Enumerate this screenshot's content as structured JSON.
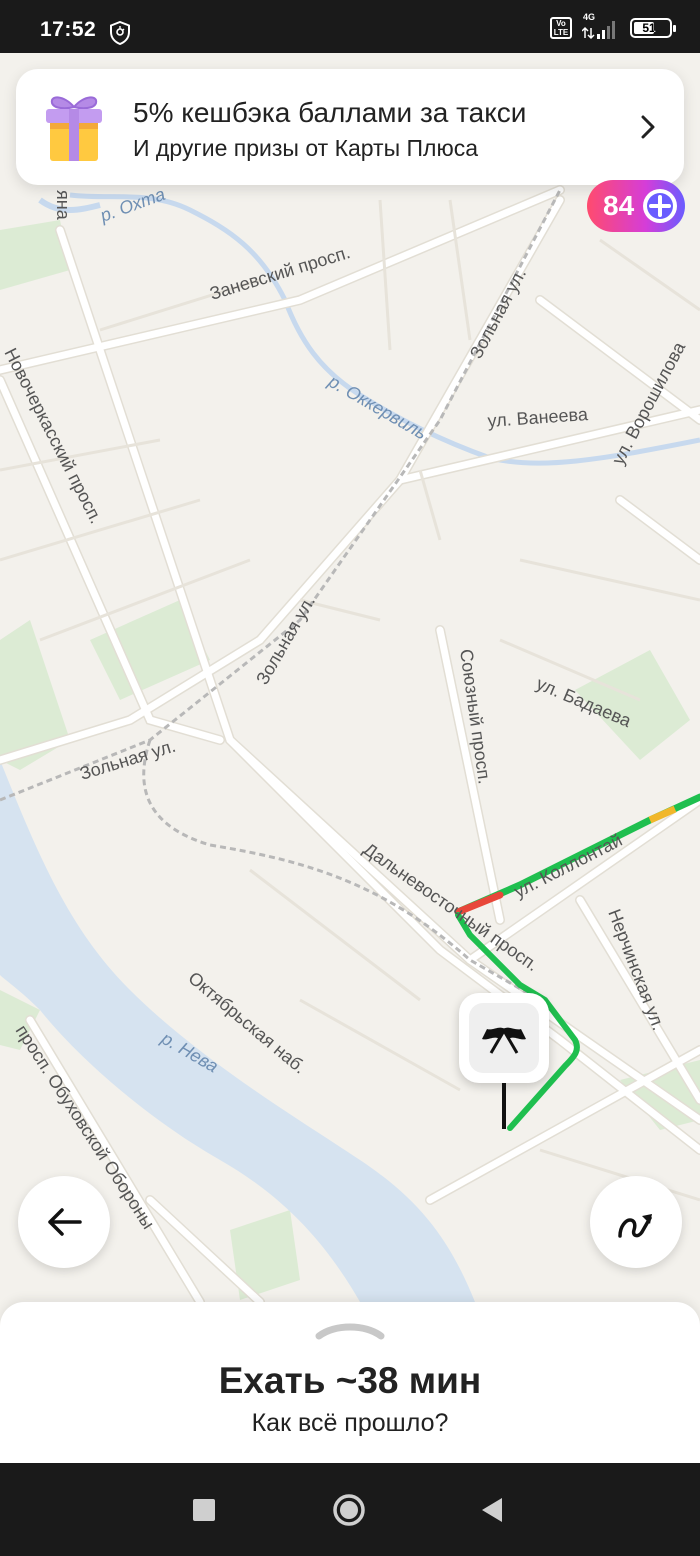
{
  "status_bar": {
    "time": "17:52",
    "network": "4G",
    "volte": "Vo LTE",
    "battery": "51"
  },
  "promo": {
    "title": "5% кешбэка баллами за такси",
    "subtitle": "И другие призы от Карты Плюса",
    "icon": "gift-icon"
  },
  "plus_badge": {
    "count": "84",
    "icon": "plus-icon"
  },
  "map": {
    "streets": [
      "Заневский просп.",
      "Зольная ул.",
      "ул. Ванеева",
      "ул. Ворошилова",
      "Новочеркасский просп.",
      "Зольная ул.",
      "Зольная ул.",
      "Союзный просп.",
      "ул. Бадаева",
      "Дальневосточный просп.",
      "ул. Коллонтай",
      "Нерчинская ул.",
      "Октябрьская наб.",
      "просп. Обуховской Обороны",
      "яна"
    ],
    "water": [
      "р. Охта",
      "р. Оккервиль",
      "р. Нева"
    ],
    "colors": {
      "route_green": "#1fbf4f",
      "route_red": "#e8473a",
      "route_yellow": "#f1b72a",
      "water": "#d6e3f0",
      "park": "#dcebd4"
    }
  },
  "buttons": {
    "back_icon": "arrow-left-icon",
    "route_icon": "route-icon",
    "finish_icon": "finish-flags-icon"
  },
  "sheet": {
    "title": "Ехать ~38 мин",
    "subtitle": "Как всё прошло?"
  },
  "nav_bar": {
    "icons": [
      "recents-icon",
      "home-icon",
      "back-icon"
    ]
  }
}
